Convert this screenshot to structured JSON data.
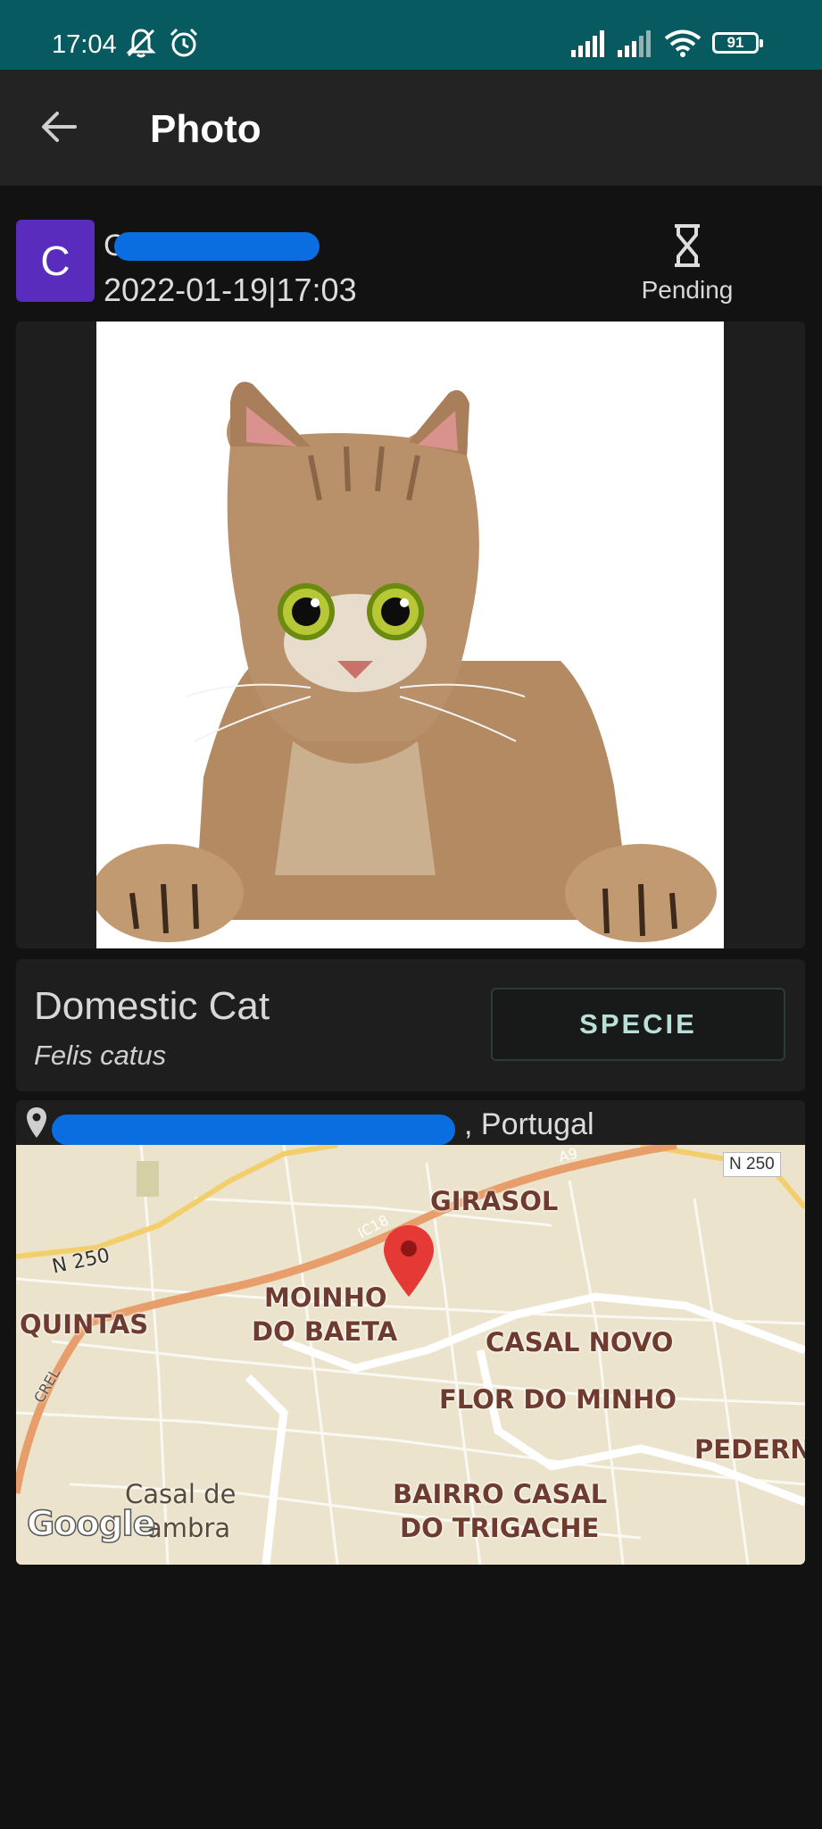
{
  "status_bar": {
    "time": "17:04",
    "battery": "91",
    "icons": [
      "mute-icon",
      "alarm-icon",
      "signal-icon",
      "signal-icon",
      "wifi-icon",
      "battery-icon"
    ]
  },
  "app_bar": {
    "title": "Photo",
    "back_icon": "arrow-left-icon"
  },
  "post": {
    "avatar_letter": "C",
    "username": "C",
    "datetime": "2022-01-19|17:03",
    "status": "Pending",
    "status_icon": "hourglass-icon"
  },
  "species": {
    "common_name": "Domestic Cat",
    "scientific_name": "Felis catus",
    "button_label": "SPECIE"
  },
  "location": {
    "text": ", Portugal",
    "pin_icon": "location-pin-icon"
  },
  "map": {
    "labels": {
      "girasol": "GIRASOL",
      "moinho1": "MOINHO",
      "moinho2": "DO BAETA",
      "quintas": "QUINTAS",
      "casal_novo": "CASAL NOVO",
      "flor_minho": "FLOR DO MINHO",
      "pedern": "PEDERN",
      "bairro1": "BAIRRO CASAL",
      "bairro2": "DO TRIGACHE",
      "casal_de": "Casal de",
      "cambra": "ambra",
      "n250_left": "N 250",
      "n250_shield": "N 250",
      "ic18": "IC18",
      "a9": "A9",
      "crel": "CREL"
    },
    "attribution": "Google"
  },
  "colors": {
    "status_bar": "#065a60",
    "app_bar": "#232323",
    "background": "#121212",
    "card": "#1e1e1e",
    "avatar": "#5a2cbd",
    "redaction": "#0a6ee0",
    "button_text": "#b9e0d8",
    "map_pin": "#e53935"
  }
}
